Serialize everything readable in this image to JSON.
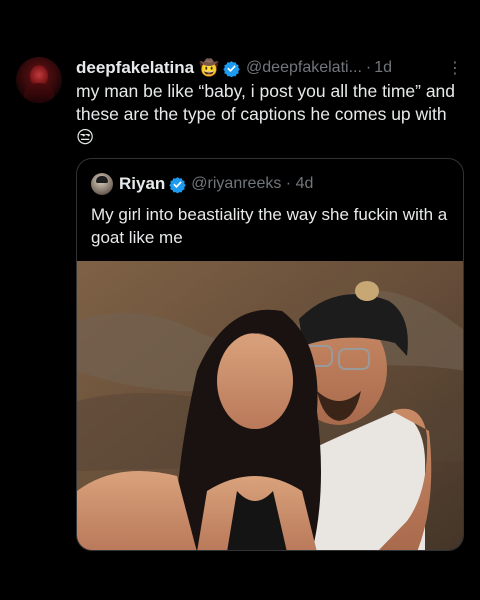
{
  "tweet": {
    "display_name": "deepfakelatina",
    "name_emoji": "🤠",
    "handle": "@deepfakelati...",
    "separator": "·",
    "time": "1d",
    "more_icon": "⋮",
    "text": "my man be like “baby, i post you all the time” and these are the type of captions he comes up with 😒"
  },
  "quote": {
    "display_name": "Riyan",
    "handle_time": "@riyanreeks · 4d",
    "text": "My girl into beastiality the way she fuckin with a goat like me",
    "photo_description_icon": "photo"
  },
  "colors": {
    "background": "#000000",
    "text": "#e7e9ea",
    "muted": "#71767b",
    "verified": "#1d9bf0",
    "border": "#2f3336"
  }
}
